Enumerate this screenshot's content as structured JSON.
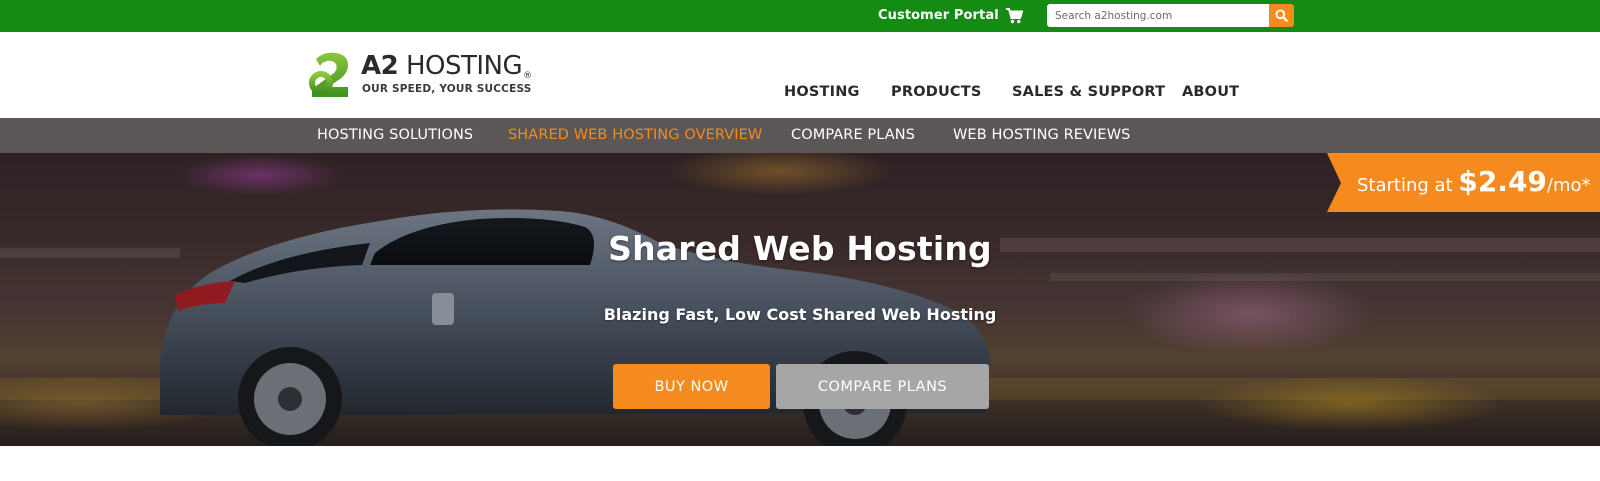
{
  "topbar": {
    "portal_label": "Customer Portal",
    "cart_icon": "cart-icon",
    "search_placeholder": "Search a2hosting.com",
    "search_icon": "search-icon",
    "bg_color": "#148b12"
  },
  "logo": {
    "name_bold": "A2",
    "name_rest": " HOSTING",
    "registered": "®",
    "tagline": "OUR SPEED, YOUR SUCCESS"
  },
  "mainnav": {
    "items": [
      {
        "label": "HOSTING"
      },
      {
        "label": "PRODUCTS"
      },
      {
        "label": "SALES & SUPPORT"
      },
      {
        "label": "ABOUT"
      }
    ]
  },
  "subnav": {
    "items": [
      {
        "label": "HOSTING SOLUTIONS"
      },
      {
        "label": "SHARED WEB HOSTING OVERVIEW"
      },
      {
        "label": "COMPARE PLANS"
      },
      {
        "label": "WEB HOSTING REVIEWS"
      }
    ],
    "active_color": "#f58b1f"
  },
  "hero": {
    "title": "Shared Web Hosting",
    "subtitle": "Blazing Fast, Low Cost Shared Web Hosting",
    "buy_label": "BUY NOW",
    "compare_label": "COMPARE PLANS"
  },
  "price": {
    "prefix": "Starting at ",
    "amount": "$2.49",
    "suffix": "/mo*",
    "color": "#f58b1f"
  }
}
